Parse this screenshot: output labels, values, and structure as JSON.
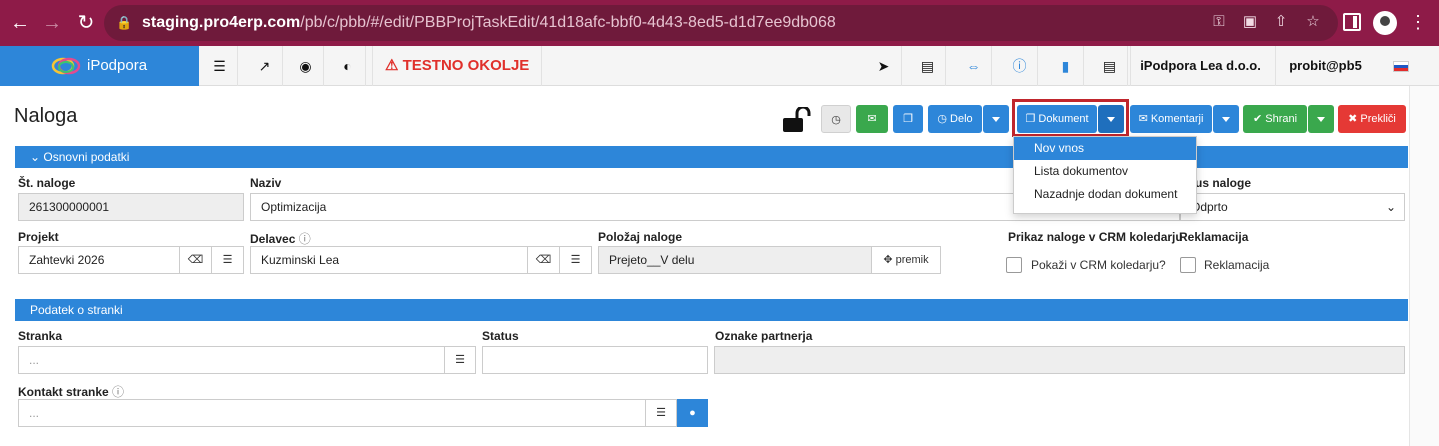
{
  "browser": {
    "url_host": "staging.pro4erp.com",
    "url_path": "/pb/c/pbb/#/edit/PBBProjTaskEdit/41d18afc-bbf0-4d43-8ed5-d1d7ee9db068"
  },
  "appbar": {
    "brand": "iPodpora",
    "environment": "TESTNO OKOLJE",
    "company": "iPodpora Lea d.o.o.",
    "user": "probit@pb5"
  },
  "page": {
    "title": "Naloga"
  },
  "toolbar": {
    "delo": "Delo",
    "dokument": "Dokument",
    "komentarji": "Komentarji",
    "shrani": "Shrani",
    "preklici": "Prekliči"
  },
  "dokument_menu": {
    "items": [
      "Nov vnos",
      "Lista dokumentov",
      "Nazadnje dodan dokument"
    ]
  },
  "section_basic": {
    "title": "Osnovni podatki",
    "st_naloge_label": "Št. naloge",
    "st_naloge_value": "261300000001",
    "naziv_label": "Naziv",
    "naziv_value": "Optimizacija",
    "status_label": "tus naloge",
    "status_value": "Odprto",
    "projekt_label": "Projekt",
    "projekt_value": "Zahtevki 2026",
    "delavec_label": "Delavec",
    "delavec_value": "Kuzminski Lea",
    "polozaj_label": "Položaj naloge",
    "polozaj_value": "Prejeto__V delu",
    "premik_label": "premik",
    "crm_label": "Prikaz naloge v CRM koledarju",
    "crm_checkbox": "Pokaži v CRM koledarju?",
    "reklamacija_label": "Reklamacija",
    "reklamacija_checkbox": "Reklamacija"
  },
  "section_customer": {
    "title": "Podatek o stranki",
    "stranka_label": "Stranka",
    "stranka_placeholder": "...",
    "status_label": "Status",
    "oznake_label": "Oznake partnerja",
    "kontakt_label": "Kontakt stranke",
    "kontakt_placeholder": "..."
  },
  "colors": {
    "chrome": "#8e1b48",
    "primary": "#2d86d9",
    "success": "#3aa84d",
    "danger": "#e53935",
    "warning_text": "#e0302b"
  }
}
